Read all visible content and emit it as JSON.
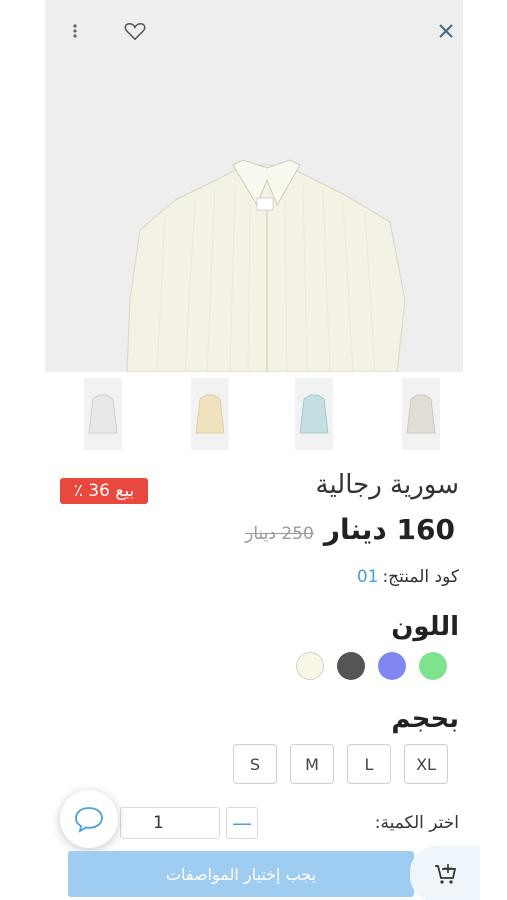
{
  "product": {
    "title": "سورية رجالية",
    "price_now": "160 دينار",
    "price_old": "250 دينار",
    "sale_badge": "بيع 36 ٪",
    "code_label": "كود المنتج:",
    "code_value": "01"
  },
  "icons": {
    "close": "close-icon",
    "favorite": "heart-icon",
    "more": "more-vertical-icon",
    "chat": "chat-bubble-icon",
    "cart": "cart-add-icon"
  },
  "gallery": {
    "thumbnails": [
      {
        "name": "white-stripe",
        "color": "#e8e8e8"
      },
      {
        "name": "beige",
        "color": "#f0e2bf"
      },
      {
        "name": "blue-stripe",
        "color": "#c5dfe2"
      },
      {
        "name": "light-gray",
        "color": "#e2ded5"
      }
    ]
  },
  "color_section": {
    "label": "اللون",
    "swatches": [
      {
        "name": "green",
        "hex": "#7de38f"
      },
      {
        "name": "purple",
        "hex": "#7f86f2"
      },
      {
        "name": "dark-gray",
        "hex": "#555555"
      },
      {
        "name": "cream",
        "hex": "#f7f6e7"
      }
    ]
  },
  "size_section": {
    "label": "بحجم",
    "sizes": [
      "XL",
      "L",
      "M",
      "S"
    ]
  },
  "quantity": {
    "label": "اختر الكمية:",
    "value": "1",
    "minus": "—"
  },
  "cta": {
    "label": "يجب إختيار المواصفات"
  },
  "colors": {
    "accent": "#4a9fe0",
    "sale": "#e8483e",
    "cta_bg": "#9fcdf1"
  }
}
